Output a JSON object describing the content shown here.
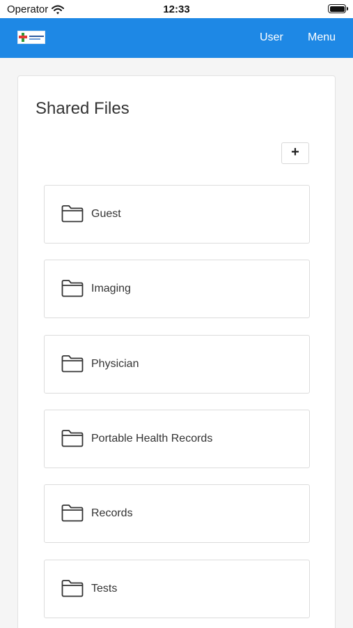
{
  "status_bar": {
    "carrier": "Operator",
    "time": "12:33"
  },
  "navbar": {
    "user_label": "User",
    "menu_label": "Menu"
  },
  "page": {
    "title": "Shared Files",
    "add_label": "+"
  },
  "folders": [
    {
      "name": "Guest"
    },
    {
      "name": "Imaging"
    },
    {
      "name": "Physician"
    },
    {
      "name": "Portable Health Records"
    },
    {
      "name": "Records"
    },
    {
      "name": "Tests"
    }
  ]
}
